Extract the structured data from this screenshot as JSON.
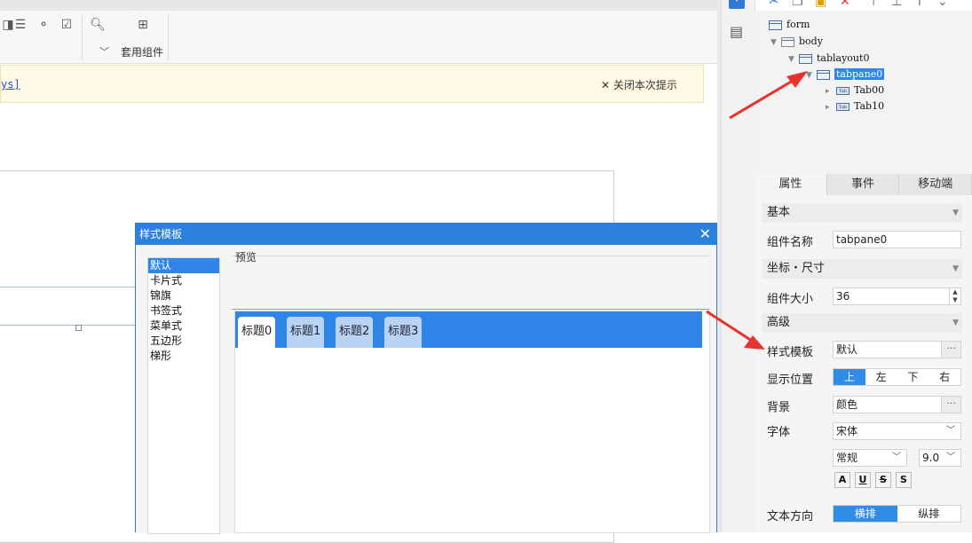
{
  "toolbar": {
    "kit_label": "套用组件"
  },
  "notice": {
    "link_text": "ys]",
    "close_label": "关闭本次提示"
  },
  "tree": {
    "nodes": [
      {
        "label": "form"
      },
      {
        "label": "body"
      },
      {
        "label": "tablayout0"
      },
      {
        "label": "tabpane0"
      },
      {
        "label": "Tab00"
      },
      {
        "label": "Tab10"
      }
    ],
    "tab_icon_text": "Tab"
  },
  "panel_tabs": [
    "属性",
    "事件",
    "移动端"
  ],
  "props": {
    "section_basic": "基本",
    "name_label": "组件名称",
    "name_value": "tabpane0",
    "section_pos": "坐标・尺寸",
    "size_label": "组件大小",
    "size_value": "36",
    "section_adv": "高级",
    "style_label": "样式模板",
    "style_value": "默认",
    "display_label": "显示位置",
    "display_options": [
      "上",
      "左",
      "下",
      "右"
    ],
    "bg_label": "背景",
    "bg_value": "颜色",
    "font_label": "字体",
    "font_value": "宋体",
    "font_style": "常规",
    "font_size": "9.0",
    "font_buttons": [
      "A",
      "U",
      "S",
      "S"
    ],
    "dir_label": "文本方向",
    "dir_options": [
      "横排",
      "纵排"
    ]
  },
  "dialog": {
    "title": "样式模板",
    "templates": [
      "默认",
      "卡片式",
      "锦旗",
      "书签式",
      "菜单式",
      "五边形",
      "梯形"
    ],
    "preview_label": "预览",
    "preview_tabs": [
      "标题0",
      "标题1",
      "标题2",
      "标题3"
    ]
  },
  "colors": {
    "accent": "#2f86e8",
    "dialog_title": "#2a82dc",
    "notice_bg": "#fff9e6",
    "arrow": "#e8322c"
  }
}
